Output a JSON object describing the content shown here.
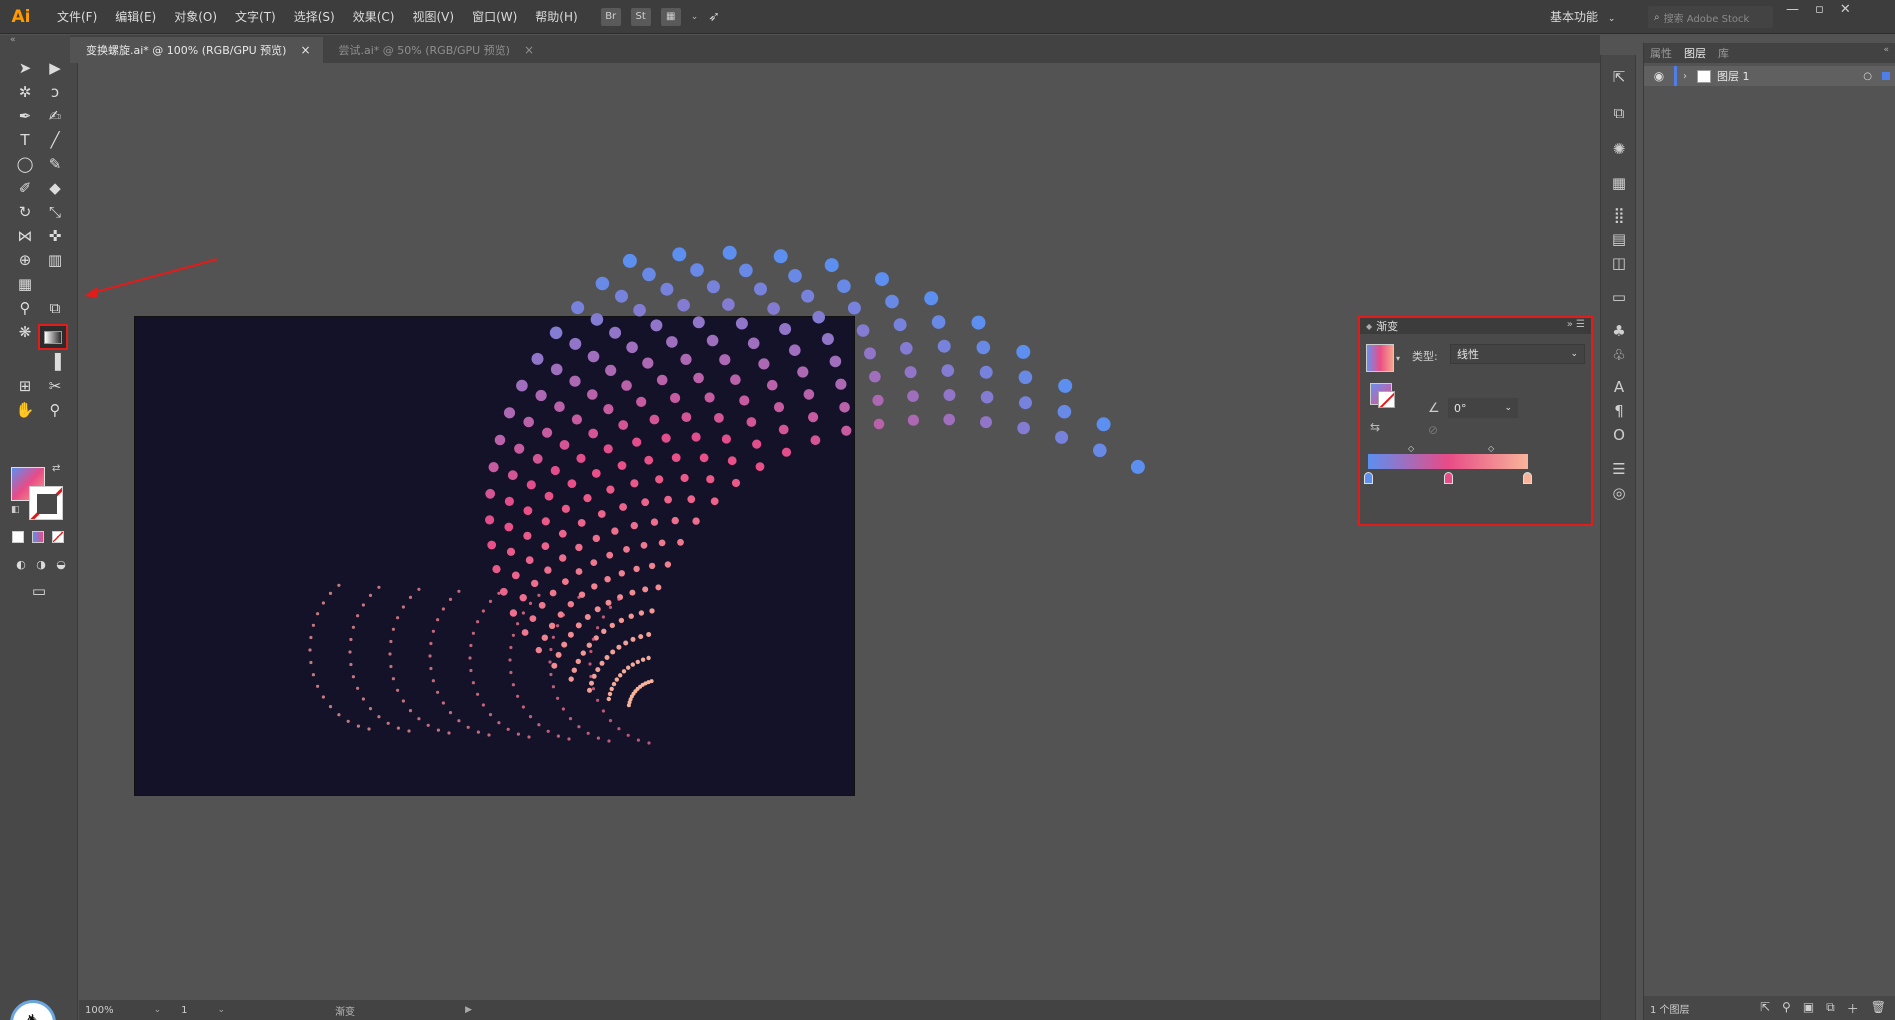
{
  "app": {
    "logo": "Ai",
    "menus": [
      "文件(F)",
      "编辑(E)",
      "对象(O)",
      "文字(T)",
      "选择(S)",
      "效果(C)",
      "视图(V)",
      "窗口(W)",
      "帮助(H)"
    ],
    "bridge_label": "Br",
    "stock_label": "St",
    "workspace": "基本功能",
    "search_placeholder": "搜索 Adobe Stock"
  },
  "tabs": [
    {
      "label": "变换螺旋.ai* @ 100% (RGB/GPU 预览)",
      "close": "×",
      "active": true
    },
    {
      "label": "尝试.ai* @ 50% (RGB/GPU 预览)",
      "close": "×",
      "active": false
    }
  ],
  "toolbar": {
    "highlighted_tool": "gradient-tool",
    "fill_colors": [
      "#5c8ff0",
      "#e84b86",
      "#f6a38a"
    ]
  },
  "gradient_panel": {
    "title": "渐变",
    "type_label": "类型:",
    "type_value": "线性",
    "angle_value": "0°",
    "stops": [
      "#5c8ff0",
      "#e84b86",
      "#f8b49a"
    ]
  },
  "layers_panel": {
    "tabs": [
      "属性",
      "图层",
      "库"
    ],
    "active_tab": "图层",
    "layer_name": "图层 1",
    "footer_count": "1 个图层"
  },
  "status": {
    "zoom": "100%",
    "page": "1",
    "tool": "渐变"
  },
  "colors": {
    "annotation_red": "#e21b1b",
    "artboard_bg": "#131228",
    "ui_bg": "#535353"
  }
}
